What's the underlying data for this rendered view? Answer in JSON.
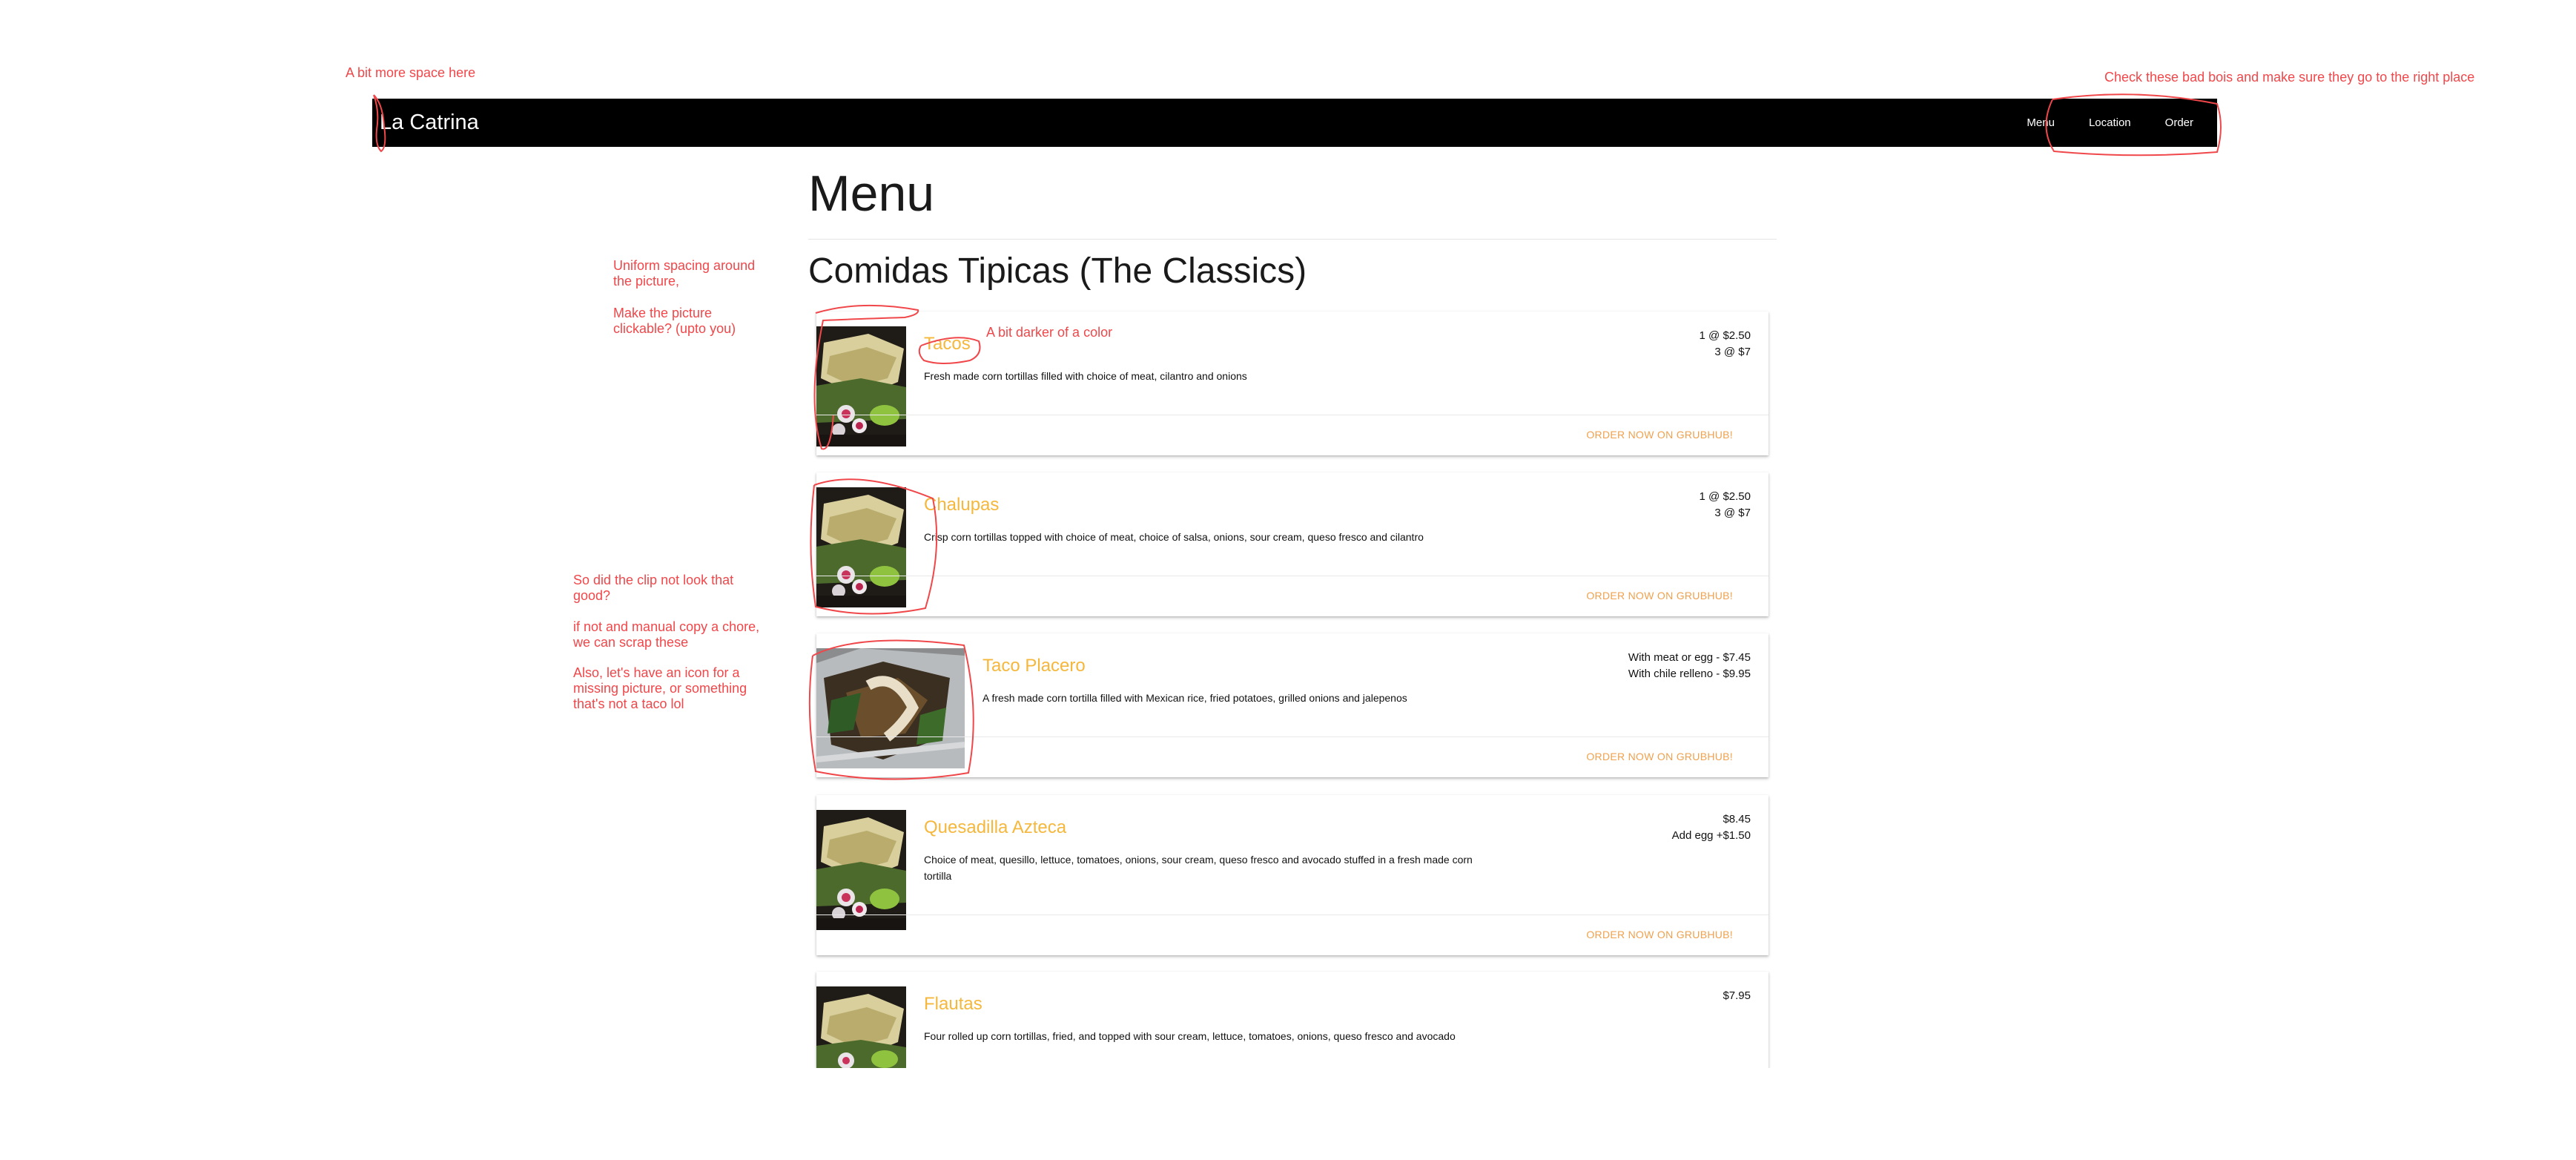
{
  "navbar": {
    "brand": "La Catrina",
    "links": [
      "Menu",
      "Location",
      "Order"
    ]
  },
  "page": {
    "title": "Menu",
    "section_title": "Comidas Tipicas (The Classics)"
  },
  "items": [
    {
      "name": "Tacos",
      "description": "Fresh made corn tortillas filled with choice of meat, cilantro and onions",
      "prices": [
        "1 @ $2.50",
        "3 @ $7"
      ],
      "order_label": "ORDER NOW ON GRUBHUB!"
    },
    {
      "name": "Chalupas",
      "description": "Crisp corn tortillas topped with choice of meat, choice of salsa, onions, sour cream, queso fresco and cilantro",
      "prices": [
        "1 @ $2.50",
        "3 @ $7"
      ],
      "order_label": "ORDER NOW ON GRUBHUB!"
    },
    {
      "name": "Taco Placero",
      "description": "A fresh made corn tortilla filled with Mexican rice, fried potatoes, grilled onions and jalepenos",
      "prices": [
        "With meat or egg - $7.45",
        "With chile relleno - $9.95"
      ],
      "order_label": "ORDER NOW ON GRUBHUB!"
    },
    {
      "name": "Quesadilla Azteca",
      "description": "Choice of meat, quesillo, lettuce, tomatoes, onions, sour cream, queso fresco and avocado stuffed in a fresh made corn tortilla",
      "prices": [
        "$8.45",
        "Add egg +$1.50"
      ],
      "order_label": "ORDER NOW ON GRUBHUB!"
    },
    {
      "name": "Flautas",
      "description": "Four rolled up corn tortillas, fried, and topped with sour cream, lettuce, tomatoes, onions, queso fresco and avocado",
      "prices": [
        "$7.95"
      ]
    }
  ],
  "annotations": {
    "space": "A bit more space here",
    "nav_links": "Check these bad bois and make sure they go to the right place",
    "spacing": [
      "Uniform spacing around",
      "the picture,"
    ],
    "clickable": [
      "Make the picture",
      "clickable? (upto you)"
    ],
    "color": "A bit darker of a color",
    "clip": [
      "So did the clip not look that",
      "good?"
    ],
    "scrap": [
      "if not and manual copy a chore,",
      "we can scrap these"
    ],
    "icon": [
      "Also, let's have an icon for a",
      "missing picture, or something",
      "that's not a taco lol"
    ]
  },
  "colors": {
    "navbar": "#000000",
    "item_name": "#f5b73c",
    "order_link": "#f0a14e",
    "annotation": "#f0474a"
  }
}
